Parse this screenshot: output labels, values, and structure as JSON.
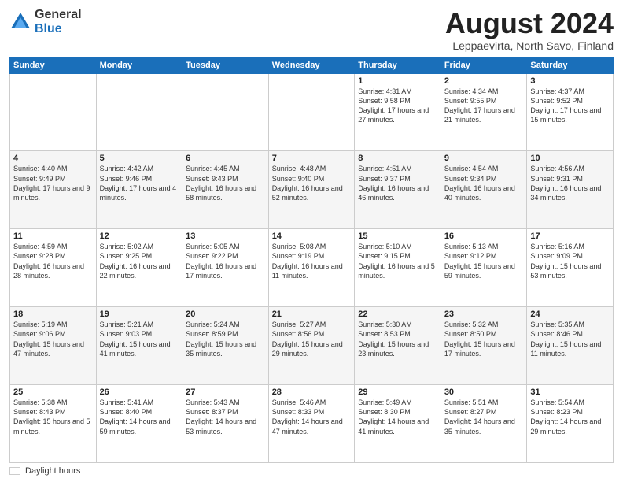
{
  "header": {
    "logo_general": "General",
    "logo_blue": "Blue",
    "month_year": "August 2024",
    "location": "Leppaevirta, North Savo, Finland"
  },
  "days_of_week": [
    "Sunday",
    "Monday",
    "Tuesday",
    "Wednesday",
    "Thursday",
    "Friday",
    "Saturday"
  ],
  "weeks": [
    [
      {
        "day": "",
        "info": ""
      },
      {
        "day": "",
        "info": ""
      },
      {
        "day": "",
        "info": ""
      },
      {
        "day": "",
        "info": ""
      },
      {
        "day": "1",
        "info": "Sunrise: 4:31 AM\nSunset: 9:58 PM\nDaylight: 17 hours\nand 27 minutes."
      },
      {
        "day": "2",
        "info": "Sunrise: 4:34 AM\nSunset: 9:55 PM\nDaylight: 17 hours\nand 21 minutes."
      },
      {
        "day": "3",
        "info": "Sunrise: 4:37 AM\nSunset: 9:52 PM\nDaylight: 17 hours\nand 15 minutes."
      }
    ],
    [
      {
        "day": "4",
        "info": "Sunrise: 4:40 AM\nSunset: 9:49 PM\nDaylight: 17 hours\nand 9 minutes."
      },
      {
        "day": "5",
        "info": "Sunrise: 4:42 AM\nSunset: 9:46 PM\nDaylight: 17 hours\nand 4 minutes."
      },
      {
        "day": "6",
        "info": "Sunrise: 4:45 AM\nSunset: 9:43 PM\nDaylight: 16 hours\nand 58 minutes."
      },
      {
        "day": "7",
        "info": "Sunrise: 4:48 AM\nSunset: 9:40 PM\nDaylight: 16 hours\nand 52 minutes."
      },
      {
        "day": "8",
        "info": "Sunrise: 4:51 AM\nSunset: 9:37 PM\nDaylight: 16 hours\nand 46 minutes."
      },
      {
        "day": "9",
        "info": "Sunrise: 4:54 AM\nSunset: 9:34 PM\nDaylight: 16 hours\nand 40 minutes."
      },
      {
        "day": "10",
        "info": "Sunrise: 4:56 AM\nSunset: 9:31 PM\nDaylight: 16 hours\nand 34 minutes."
      }
    ],
    [
      {
        "day": "11",
        "info": "Sunrise: 4:59 AM\nSunset: 9:28 PM\nDaylight: 16 hours\nand 28 minutes."
      },
      {
        "day": "12",
        "info": "Sunrise: 5:02 AM\nSunset: 9:25 PM\nDaylight: 16 hours\nand 22 minutes."
      },
      {
        "day": "13",
        "info": "Sunrise: 5:05 AM\nSunset: 9:22 PM\nDaylight: 16 hours\nand 17 minutes."
      },
      {
        "day": "14",
        "info": "Sunrise: 5:08 AM\nSunset: 9:19 PM\nDaylight: 16 hours\nand 11 minutes."
      },
      {
        "day": "15",
        "info": "Sunrise: 5:10 AM\nSunset: 9:15 PM\nDaylight: 16 hours\nand 5 minutes."
      },
      {
        "day": "16",
        "info": "Sunrise: 5:13 AM\nSunset: 9:12 PM\nDaylight: 15 hours\nand 59 minutes."
      },
      {
        "day": "17",
        "info": "Sunrise: 5:16 AM\nSunset: 9:09 PM\nDaylight: 15 hours\nand 53 minutes."
      }
    ],
    [
      {
        "day": "18",
        "info": "Sunrise: 5:19 AM\nSunset: 9:06 PM\nDaylight: 15 hours\nand 47 minutes."
      },
      {
        "day": "19",
        "info": "Sunrise: 5:21 AM\nSunset: 9:03 PM\nDaylight: 15 hours\nand 41 minutes."
      },
      {
        "day": "20",
        "info": "Sunrise: 5:24 AM\nSunset: 8:59 PM\nDaylight: 15 hours\nand 35 minutes."
      },
      {
        "day": "21",
        "info": "Sunrise: 5:27 AM\nSunset: 8:56 PM\nDaylight: 15 hours\nand 29 minutes."
      },
      {
        "day": "22",
        "info": "Sunrise: 5:30 AM\nSunset: 8:53 PM\nDaylight: 15 hours\nand 23 minutes."
      },
      {
        "day": "23",
        "info": "Sunrise: 5:32 AM\nSunset: 8:50 PM\nDaylight: 15 hours\nand 17 minutes."
      },
      {
        "day": "24",
        "info": "Sunrise: 5:35 AM\nSunset: 8:46 PM\nDaylight: 15 hours\nand 11 minutes."
      }
    ],
    [
      {
        "day": "25",
        "info": "Sunrise: 5:38 AM\nSunset: 8:43 PM\nDaylight: 15 hours\nand 5 minutes."
      },
      {
        "day": "26",
        "info": "Sunrise: 5:41 AM\nSunset: 8:40 PM\nDaylight: 14 hours\nand 59 minutes."
      },
      {
        "day": "27",
        "info": "Sunrise: 5:43 AM\nSunset: 8:37 PM\nDaylight: 14 hours\nand 53 minutes."
      },
      {
        "day": "28",
        "info": "Sunrise: 5:46 AM\nSunset: 8:33 PM\nDaylight: 14 hours\nand 47 minutes."
      },
      {
        "day": "29",
        "info": "Sunrise: 5:49 AM\nSunset: 8:30 PM\nDaylight: 14 hours\nand 41 minutes."
      },
      {
        "day": "30",
        "info": "Sunrise: 5:51 AM\nSunset: 8:27 PM\nDaylight: 14 hours\nand 35 minutes."
      },
      {
        "day": "31",
        "info": "Sunrise: 5:54 AM\nSunset: 8:23 PM\nDaylight: 14 hours\nand 29 minutes."
      }
    ]
  ],
  "footer": {
    "legend_label": "Daylight hours"
  }
}
